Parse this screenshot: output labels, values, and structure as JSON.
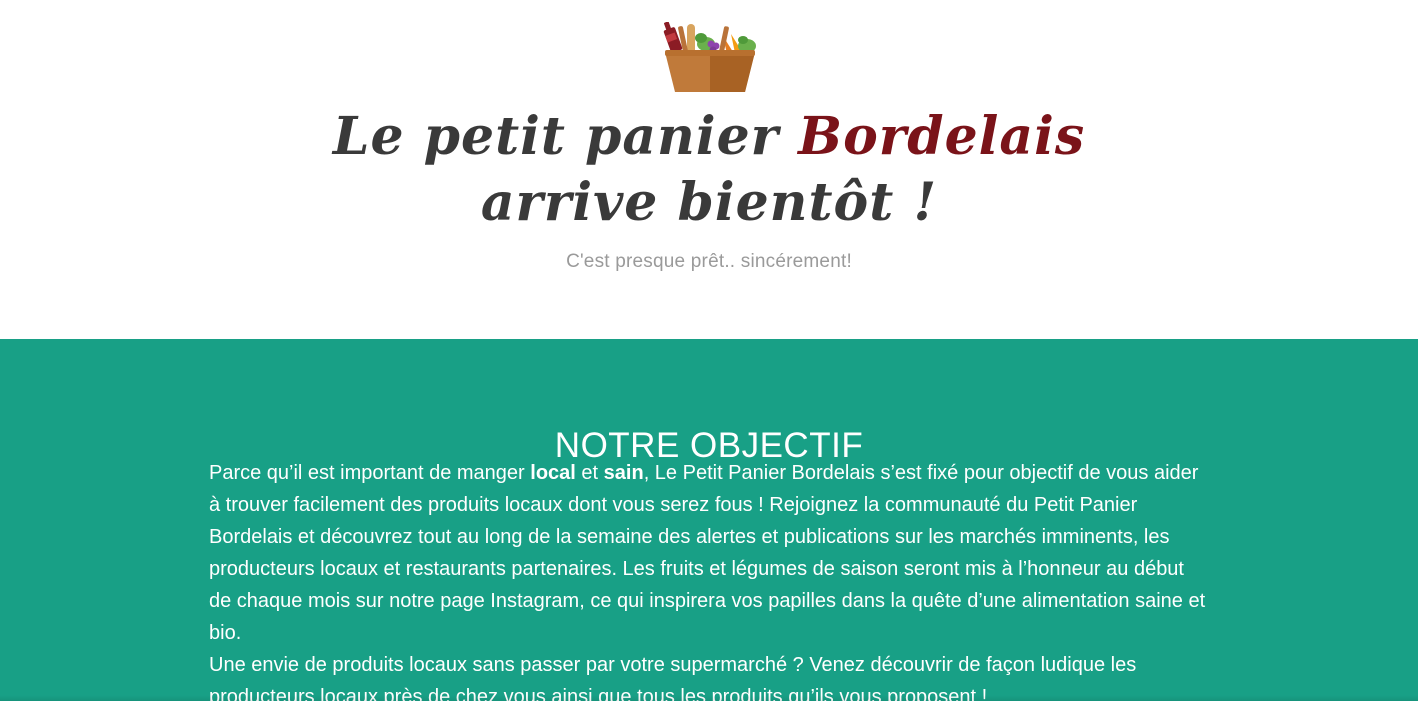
{
  "hero": {
    "logo_icon": "basket-icon",
    "headline_line1_prefix": "Le petit panier ",
    "headline_line1_brand": "Bordelais",
    "headline_line2": "arrive bientôt !",
    "subtitle": "C'est presque prêt.. sincérement!"
  },
  "objective": {
    "title": "NOTRE OBJECTIF",
    "p1_part1": "Parce qu’il est important de manger ",
    "p1_bold1": "local",
    "p1_part2": " et ",
    "p1_bold2": "sain",
    "p1_part3": ", Le Petit Panier Bordelais s’est fixé pour objectif de vous aider à trouver facilement des produits locaux dont vous serez fous ! Rejoignez la communauté du Petit Panier Bordelais et découvrez tout au long de la semaine des alertes et publications sur les marchés imminents, les producteurs locaux et restaurants partenaires. Les fruits et légumes de saison seront mis à l’honneur au début de chaque mois sur notre page Instagram, ce qui inspirera vos papilles dans la quête d’une alimentation saine et bio.",
    "p2": "Une envie de produits locaux sans passer par votre supermarché ? Venez découvrir de façon ludique les producteurs locaux près de chez vous ainsi que tous les produits qu’ils vous proposent !"
  },
  "colors": {
    "brand_red": "#7a1319",
    "teal_background": "#18a086",
    "headline_text": "#3a3a3a",
    "subtitle_text": "#9a9a9a"
  }
}
